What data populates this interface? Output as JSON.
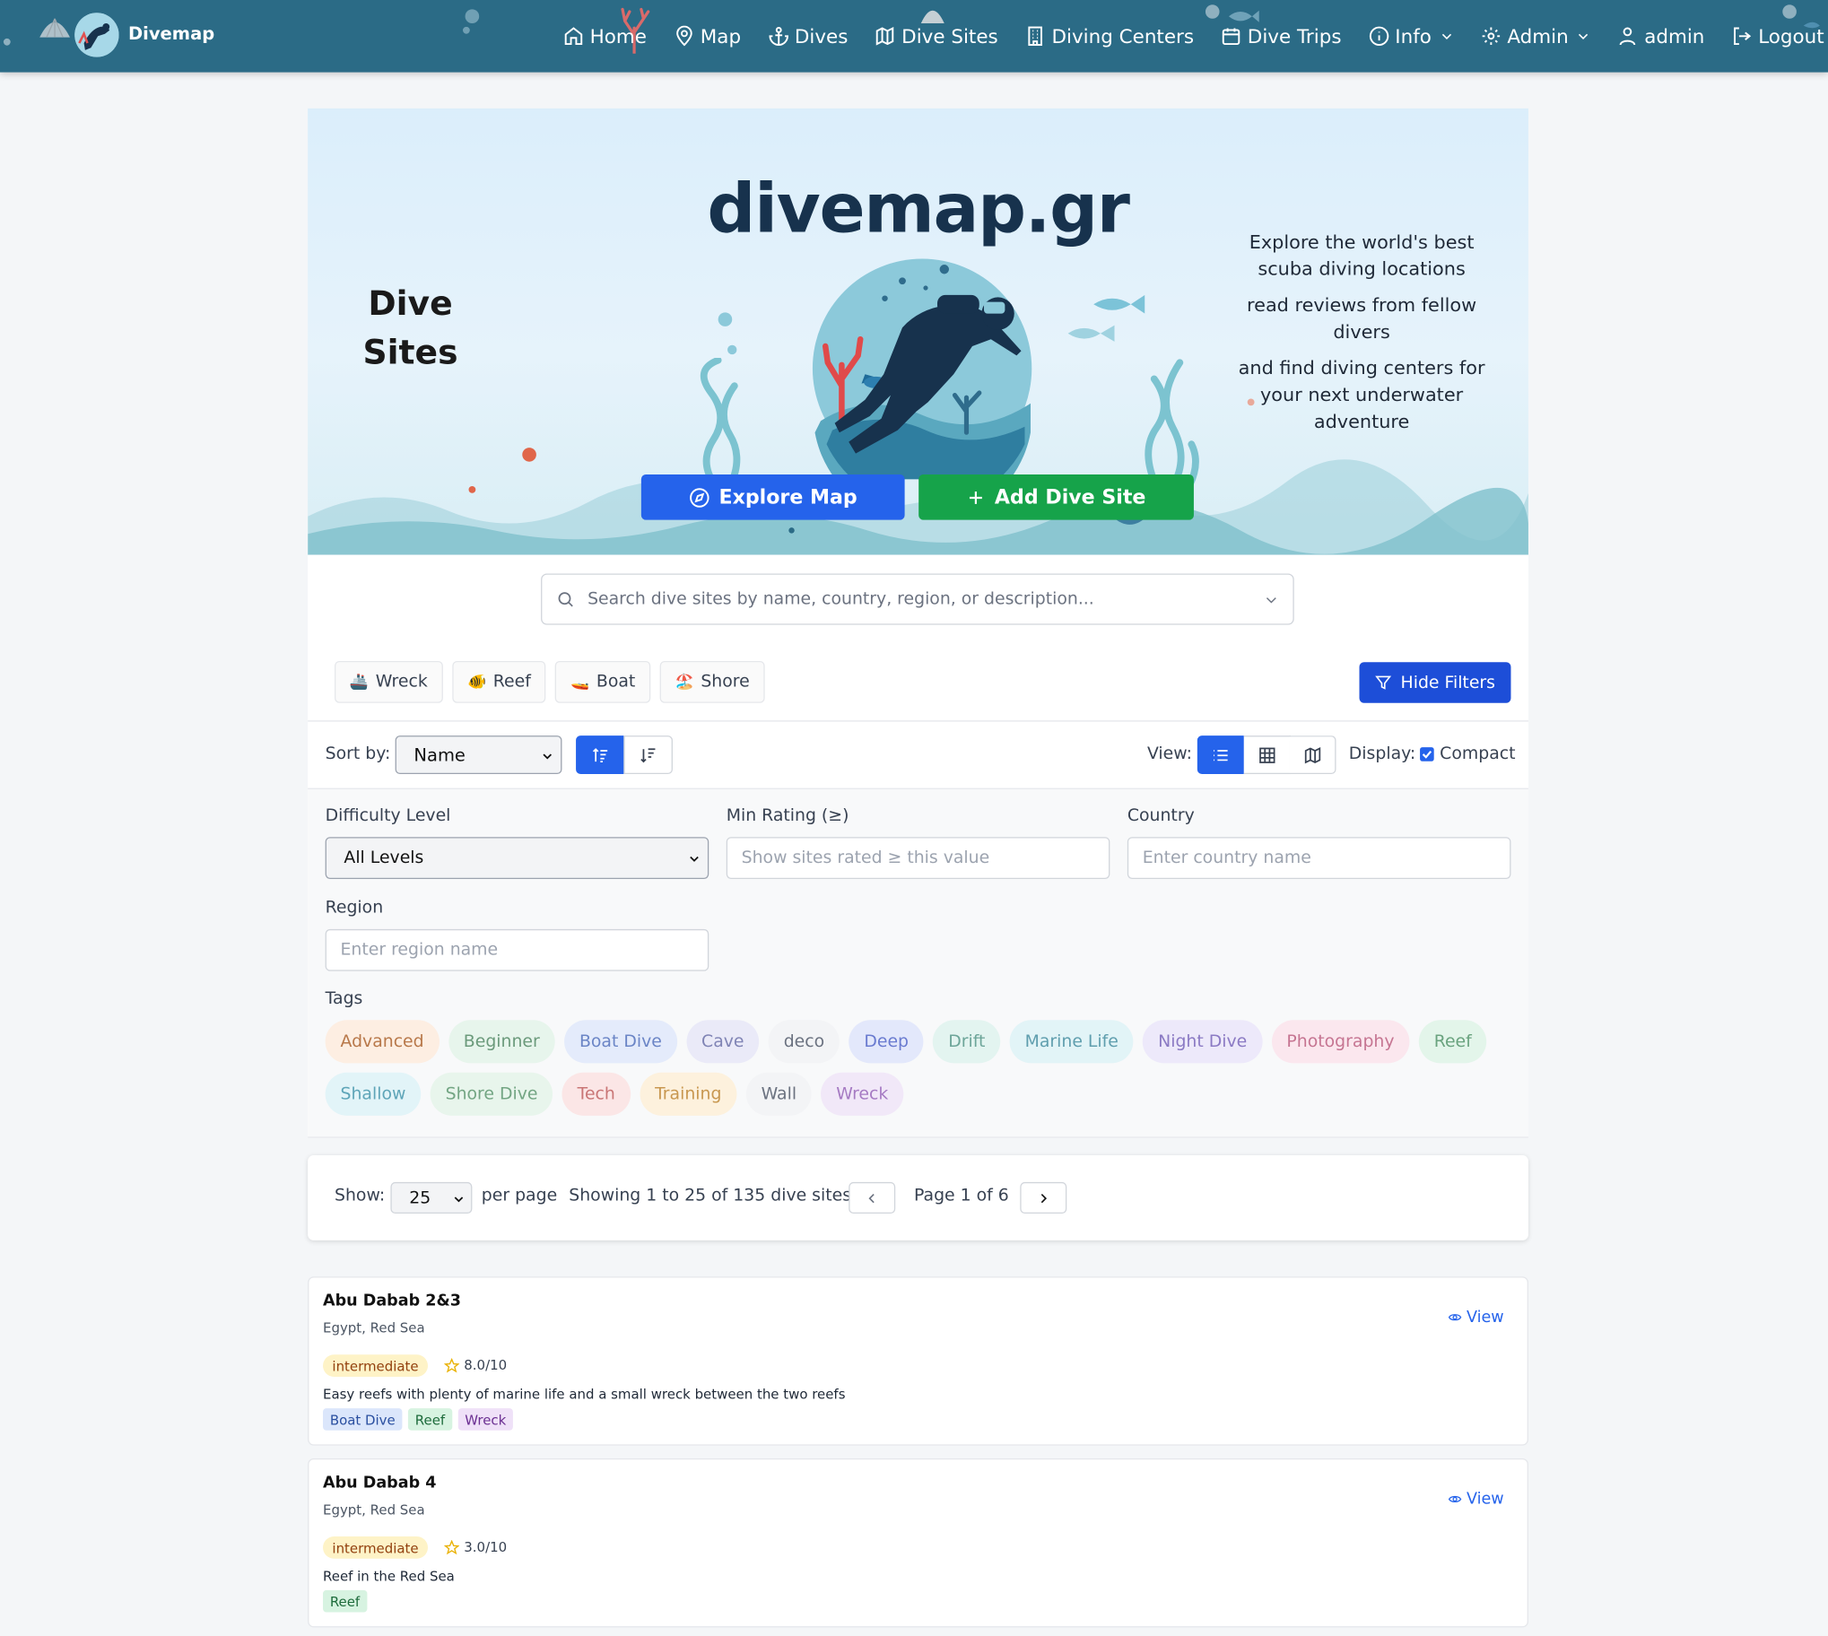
{
  "nav": {
    "brand": "Divemap",
    "items": [
      {
        "label": "Home",
        "icon": "home-icon"
      },
      {
        "label": "Map",
        "icon": "map-pin-icon"
      },
      {
        "label": "Dives",
        "icon": "anchor-icon"
      },
      {
        "label": "Dive Sites",
        "icon": "map-icon"
      },
      {
        "label": "Diving Centers",
        "icon": "building-icon"
      },
      {
        "label": "Dive Trips",
        "icon": "calendar-icon"
      },
      {
        "label": "Info",
        "icon": "info-icon"
      },
      {
        "label": "Admin",
        "icon": "settings-icon"
      },
      {
        "label": "admin",
        "icon": "user-icon"
      },
      {
        "label": "Logout",
        "icon": "logout-icon"
      }
    ]
  },
  "hero": {
    "logo_text": "divemap.gr",
    "left_title": "Dive Sites",
    "right_lines": [
      "Explore the world's best scuba diving locations",
      "read reviews from fellow divers",
      "and find diving centers for your next underwater adventure"
    ],
    "explore_label": "Explore Map",
    "add_label": "Add Dive Site"
  },
  "search": {
    "placeholder": "Search dive sites by name, country, region, or description..."
  },
  "quick_filters": [
    {
      "emoji": "🚢",
      "label": "Wreck"
    },
    {
      "emoji": "🐠",
      "label": "Reef"
    },
    {
      "emoji": "🚤",
      "label": "Boat"
    },
    {
      "emoji": "🏖️",
      "label": "Shore"
    }
  ],
  "hide_filters_label": "Hide Filters",
  "sort": {
    "label": "Sort by:",
    "value": "Name"
  },
  "view": {
    "label": "View:",
    "active": "list"
  },
  "display": {
    "label": "Display:",
    "compact_label": "Compact",
    "compact_checked": true
  },
  "filters": {
    "difficulty_label": "Difficulty Level",
    "difficulty_value": "All Levels",
    "min_rating_label": "Min Rating (≥)",
    "min_rating_placeholder": "Show sites rated ≥ this value",
    "country_label": "Country",
    "country_placeholder": "Enter country name",
    "region_label": "Region",
    "region_placeholder": "Enter region name",
    "tags_label": "Tags",
    "tags": [
      {
        "label": "Advanced",
        "bg": "#fdeee2",
        "fg": "#b8784a"
      },
      {
        "label": "Beginner",
        "bg": "#e7f5ec",
        "fg": "#6b9a7b"
      },
      {
        "label": "Boat Dive",
        "bg": "#e4ebfb",
        "fg": "#6b85c6"
      },
      {
        "label": "Cave",
        "bg": "#eaeaf8",
        "fg": "#8084b5"
      },
      {
        "label": "deco",
        "bg": "#f3f4f6",
        "fg": "#6b7280"
      },
      {
        "label": "Deep",
        "bg": "#e3e8fb",
        "fg": "#6a7bd0"
      },
      {
        "label": "Drift",
        "bg": "#e3f4f0",
        "fg": "#6da599"
      },
      {
        "label": "Marine Life",
        "bg": "#e2f4f7",
        "fg": "#5f9eae"
      },
      {
        "label": "Night Dive",
        "bg": "#ede9fa",
        "fg": "#8b7ac4"
      },
      {
        "label": "Photography",
        "bg": "#fbe7ee",
        "fg": "#c67592"
      },
      {
        "label": "Reef",
        "bg": "#e3f5ea",
        "fg": "#6aa37f"
      },
      {
        "label": "Shallow",
        "bg": "#e2f4f8",
        "fg": "#5ea5b8"
      },
      {
        "label": "Shore Dive",
        "bg": "#e8f5ec",
        "fg": "#73a583"
      },
      {
        "label": "Tech",
        "bg": "#fbe6e6",
        "fg": "#c97575"
      },
      {
        "label": "Training",
        "bg": "#fdf1dd",
        "fg": "#c8974f"
      },
      {
        "label": "Wall",
        "bg": "#f3f4f6",
        "fg": "#6b7280"
      },
      {
        "label": "Wreck",
        "bg": "#f1e8f8",
        "fg": "#a67bc3"
      }
    ]
  },
  "pagination": {
    "show_label": "Show:",
    "page_size": "25",
    "per_page_label": "per page",
    "summary": "Showing 1 to 25 of 135 dive sites",
    "page_label": "Page 1 of 6"
  },
  "sites": [
    {
      "name": "Abu Dabab 2&3",
      "location": "Egypt, Red Sea",
      "difficulty": "intermediate",
      "rating": "8.0/10",
      "description": "Easy reefs with plenty of marine life and a small wreck between the two reefs",
      "tags": [
        {
          "label": "Boat Dive",
          "bg": "#dbe6fb",
          "fg": "#2a4fa0"
        },
        {
          "label": "Reef",
          "bg": "#d7f3e1",
          "fg": "#1d6b3b"
        },
        {
          "label": "Wreck",
          "bg": "#efe1f8",
          "fg": "#6b2f92"
        }
      ],
      "view_label": "View"
    },
    {
      "name": "Abu Dabab 4",
      "location": "Egypt, Red Sea",
      "difficulty": "intermediate",
      "rating": "3.0/10",
      "description": "Reef in the Red Sea",
      "tags": [
        {
          "label": "Reef",
          "bg": "#d7f3e1",
          "fg": "#1d6b3b"
        }
      ],
      "view_label": "View"
    }
  ]
}
